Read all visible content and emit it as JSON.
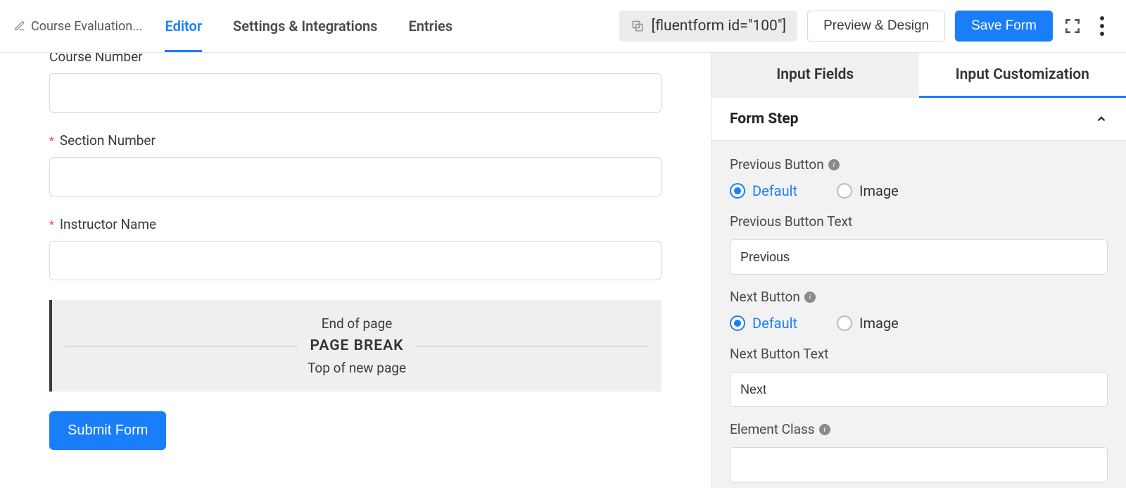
{
  "header": {
    "form_title": "Course Evaluation...",
    "tabs": [
      {
        "label": "Editor",
        "active": true
      },
      {
        "label": "Settings & Integrations",
        "active": false
      },
      {
        "label": "Entries",
        "active": false
      }
    ],
    "shortcode": "[fluentform id=\"100\"]",
    "preview_label": "Preview & Design",
    "save_label": "Save Form"
  },
  "editor": {
    "fields": [
      {
        "label": "Course Number",
        "required": false
      },
      {
        "label": "Section Number",
        "required": true
      },
      {
        "label": "Instructor Name",
        "required": true
      }
    ],
    "page_break": {
      "end_text": "End of page",
      "title": "PAGE BREAK",
      "top_text": "Top of new page"
    },
    "submit_label": "Submit Form"
  },
  "sidebar": {
    "tabs": [
      {
        "label": "Input Fields",
        "active": false
      },
      {
        "label": "Input Customization",
        "active": true
      }
    ],
    "panel_title": "Form Step",
    "prev_button": {
      "label": "Previous Button",
      "options": {
        "default": "Default",
        "image": "Image"
      },
      "selected": "default",
      "text_label": "Previous Button Text",
      "text_value": "Previous"
    },
    "next_button": {
      "label": "Next Button",
      "options": {
        "default": "Default",
        "image": "Image"
      },
      "selected": "default",
      "text_label": "Next Button Text",
      "text_value": "Next"
    },
    "element_class_label": "Element Class"
  }
}
